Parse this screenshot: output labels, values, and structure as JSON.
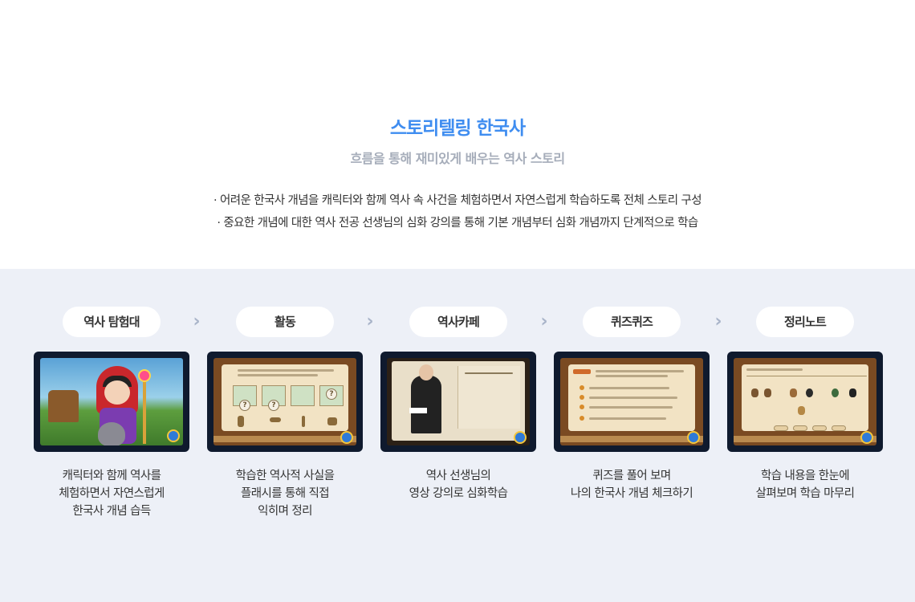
{
  "header": {
    "title": "스토리텔링 한국사",
    "subtitle": "흐름을 통해 재미있게 배우는 역사 스토리",
    "bullets": [
      "· 어려운 한국사 개념을 캐릭터와 함께 역사 속 사건을 체험하면서 자연스럽게 학습하도록 전체 스토리 구성",
      "· 중요한 개념에 대한 역사 전공 선생님의 심화 강의를 통해 기본 개념부터 심화 개념까지 단계적으로 학습"
    ]
  },
  "colors": {
    "title": "#3f8df0",
    "subtitle": "#a6adba",
    "bottom_background": "#edf0f7",
    "frame": "#0f1a2e",
    "chevron": "#a9b4c9"
  },
  "steps": [
    {
      "label": "역사 탐험대",
      "desc": [
        "캐릭터와 함께 역사를",
        "체험하면서 자연스럽게",
        "한국사 개념 습득"
      ]
    },
    {
      "label": "활동",
      "desc": [
        "학습한 역사적 사실을",
        "플래시를 통해 직접",
        "익히며 정리"
      ]
    },
    {
      "label": "역사카페",
      "desc": [
        "역사 선생님의",
        "영상 강의로 심화학습"
      ]
    },
    {
      "label": "퀴즈퀴즈",
      "desc": [
        "퀴즈를 풀어 보며",
        "나의 한국사 개념 체크하기"
      ]
    },
    {
      "label": "정리노트",
      "desc": [
        "학습 내용을 한눈에",
        "살펴보며 학습 마무리"
      ]
    }
  ],
  "icons": {
    "separator": "chevron-right-icon"
  }
}
